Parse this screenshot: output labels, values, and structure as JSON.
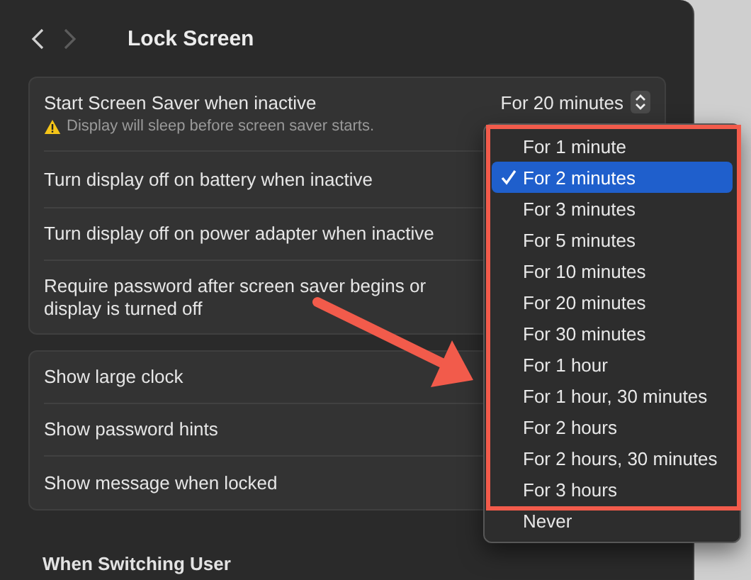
{
  "window": {
    "title": "Lock Screen"
  },
  "navigation": {
    "back_enabled": true,
    "forward_enabled": false
  },
  "settings_group_1": [
    {
      "label": "Start Screen Saver when inactive",
      "note": "Display will sleep before screen saver starts.",
      "value": "For 20 minutes"
    },
    {
      "label": "Turn display off on battery when inactive"
    },
    {
      "label": "Turn display off on power adapter when inactive"
    },
    {
      "label": "Require password after screen saver begins or display is turned off"
    }
  ],
  "settings_group_2": [
    {
      "label": "Show large clock"
    },
    {
      "label": "Show password hints"
    },
    {
      "label": "Show message when locked"
    }
  ],
  "section_heading": "When Switching User",
  "menu": {
    "items": [
      {
        "label": "For 1 minute",
        "selected": false
      },
      {
        "label": "For 2 minutes",
        "selected": true
      },
      {
        "label": "For 3 minutes",
        "selected": false
      },
      {
        "label": "For 5 minutes",
        "selected": false
      },
      {
        "label": "For 10 minutes",
        "selected": false
      },
      {
        "label": "For 20 minutes",
        "selected": false
      },
      {
        "label": "For 30 minutes",
        "selected": false
      },
      {
        "label": "For 1 hour",
        "selected": false
      },
      {
        "label": "For 1 hour, 30 minutes",
        "selected": false
      },
      {
        "label": "For 2 hours",
        "selected": false
      },
      {
        "label": "For 2 hours, 30 minutes",
        "selected": false
      },
      {
        "label": "For 3 hours",
        "selected": false
      },
      {
        "label": "Never",
        "selected": false
      }
    ]
  }
}
